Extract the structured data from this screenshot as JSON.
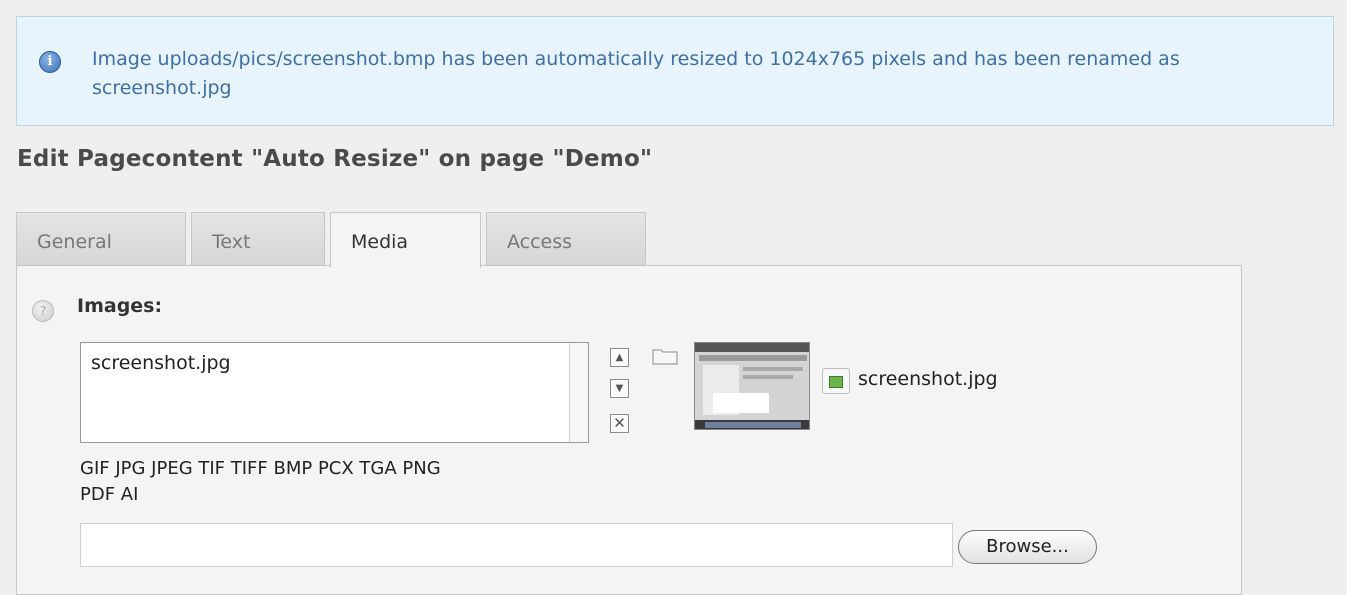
{
  "notice": {
    "icon": "info-icon",
    "text": "Image uploads/pics/screenshot.bmp has been automatically resized to 1024x765 pixels and has been renamed as screenshot.jpg"
  },
  "heading": "Edit Pagecontent \"Auto Resize\" on page \"Demo\"",
  "tabs": [
    {
      "label": "General",
      "active": false
    },
    {
      "label": "Text",
      "active": false
    },
    {
      "label": "Media",
      "active": true
    },
    {
      "label": "Access",
      "active": false
    }
  ],
  "images": {
    "label": "Images:",
    "list_items": [
      "screenshot.jpg"
    ],
    "file_name": "screenshot.jpg",
    "allowed_types_line1": "GIF JPG JPEG TIF TIFF BMP PCX TGA PNG",
    "allowed_types_line2": "PDF AI",
    "file_input_value": "",
    "browse_label": "Browse..."
  },
  "colors": {
    "notice_bg": "#e8f4fd",
    "notice_text": "#3f6fa4",
    "page_bg": "#efefef"
  }
}
